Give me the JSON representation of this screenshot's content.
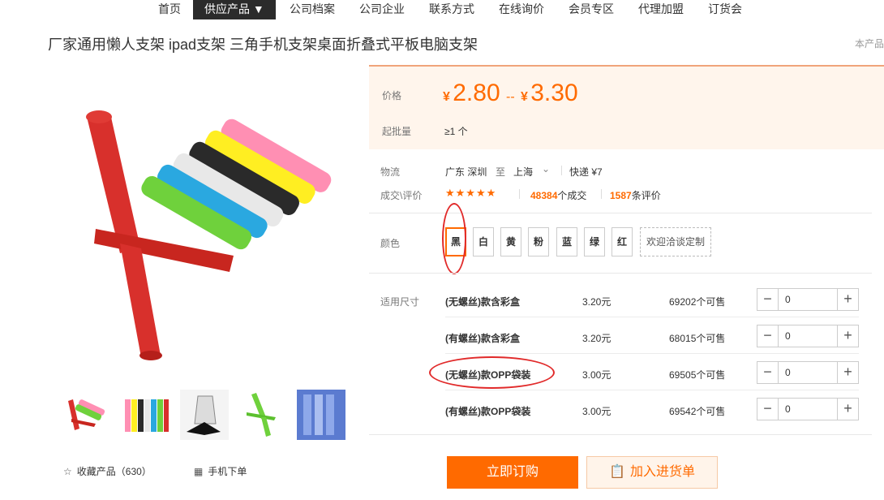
{
  "nav": {
    "items": [
      "首页",
      "供应产品 ▼",
      "公司档案",
      "公司企业",
      "联系方式",
      "在线询价",
      "会员专区",
      "代理加盟",
      "订货会"
    ]
  },
  "product": {
    "title": "厂家通用懒人支架 ipad支架 三角手机支架桌面折叠式平板电脑支架",
    "side_note": "本产品"
  },
  "price": {
    "label": "价格",
    "currency": "¥",
    "low": "2.80",
    "sep": "--",
    "high": "3.30",
    "moq_label": "起批量",
    "moq_value": "≥1 个"
  },
  "logistics": {
    "label": "物流",
    "from": "广东 深圳",
    "to_word": "至",
    "to": "上海",
    "express": "快递 ¥7"
  },
  "reviews": {
    "label": "成交\\评价",
    "stars": "★★★★★",
    "deals_count": "48384",
    "deals_suffix": "个成交",
    "reviews_count": "1587",
    "reviews_suffix": "条评价"
  },
  "colors": {
    "label": "颜色",
    "options": [
      "黑",
      "白",
      "黄",
      "粉",
      "蓝",
      "绿",
      "红"
    ],
    "selected": "黑",
    "custom": "欢迎洽谈定制"
  },
  "sizes": {
    "label": "适用尺寸",
    "rows": [
      {
        "name": "(无螺丝)款含彩盒",
        "price": "3.20元",
        "stock": "69202个可售",
        "qty": "0"
      },
      {
        "name": "(有螺丝)款含彩盒",
        "price": "3.20元",
        "stock": "68015个可售",
        "qty": "0"
      },
      {
        "name": "(无螺丝)款OPP袋装",
        "price": "3.00元",
        "stock": "69505个可售",
        "qty": "0"
      },
      {
        "name": "(有螺丝)款OPP袋装",
        "price": "3.00元",
        "stock": "69542个可售",
        "qty": "0"
      }
    ]
  },
  "actions": {
    "favorite": "收藏产品（630）",
    "mobile_order": "手机下单",
    "buy_now": "立即订购",
    "add_to_cart": "加入进货单"
  },
  "icons": {
    "favorite": "star-outline-icon",
    "mobile_order": "qr-grid-icon",
    "add_to_cart": "clipboard-icon",
    "dropdown": "chevron-down-icon"
  },
  "accent_color": "#ff6a00",
  "annotation_color": "#e12a2a"
}
